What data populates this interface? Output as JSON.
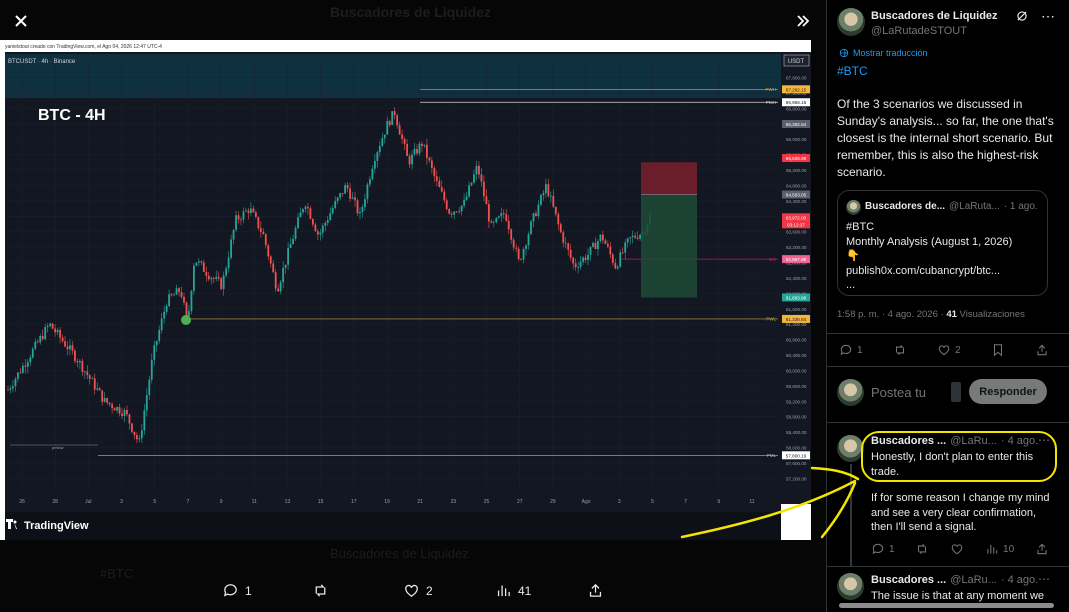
{
  "header": {
    "title": "Buscadores de Liquidez"
  },
  "chart_window": {
    "attribution": "yanielstout creado con TradingView.com, el Ago 04, 2026 12:47 UTC-4",
    "symbol": "BTCUSDT · 4h · Binance",
    "currency": "USDT",
    "overlay_title": "BTC - 4H",
    "brand": "TradingView",
    "level_tags": [
      "PWH",
      "PMH",
      "MO",
      "PWL",
      "PML"
    ],
    "small_label": "pmlow"
  },
  "chart_data": {
    "type": "candlestick",
    "symbol": "BTCUSDT",
    "timeframe": "4h",
    "exchange": "Binance",
    "x_tick_labels": [
      "26",
      "28",
      "Jul",
      "3",
      "5",
      "7",
      "9",
      "11",
      "13",
      "15",
      "17",
      "19",
      "21",
      "23",
      "25",
      "27",
      "29",
      "Ago",
      "3",
      "5",
      "7",
      "9",
      "11"
    ],
    "y_tick_labels": [
      "67,600.00",
      "67,200.00",
      "66,800.00",
      "66,400.00",
      "66,000.00",
      "65,600.00",
      "65,200.00",
      "64,800.00",
      "64,400.00",
      "64,000.00",
      "63,600.00",
      "63,200.00",
      "62,800.00",
      "62,400.00",
      "62,000.00",
      "61,600.00",
      "61,200.00",
      "60,800.00",
      "60,400.00",
      "60,000.00",
      "59,600.00",
      "59,200.00",
      "58,800.00",
      "58,400.00",
      "58,000.00",
      "57,600.00",
      "57,200.00"
    ],
    "ylim": [
      56900,
      68000
    ],
    "price_level_badges": [
      {
        "value": "67,292.15",
        "color": "#f5b73b"
      },
      {
        "value": "66,956.15",
        "color": "#ffffff"
      },
      {
        "value": "66,392.64",
        "color": "#5d606b"
      },
      {
        "value": "65,508.89",
        "color": "#f23645"
      },
      {
        "value": "64,563.05",
        "color": "#5d606b"
      },
      {
        "value": "63,972.00",
        "color": "#f23645"
      },
      {
        "value": "03:12:37",
        "color": "#f23645"
      },
      {
        "value": "62,887.88",
        "color": "#f06292"
      },
      {
        "value": "61,893.98",
        "color": "#26a69a"
      },
      {
        "value": "61,336.84",
        "color": "#f5b73b"
      },
      {
        "value": "57,800.19",
        "color": "#ffffff"
      }
    ],
    "levels": [
      {
        "name": "PWH",
        "price": 67292.15
      },
      {
        "name": "PMH",
        "price": 66956.15
      },
      {
        "name": "MO",
        "price": 62887.88
      },
      {
        "name": "PWL",
        "price": 61336.84
      },
      {
        "name": "PML",
        "price": 57800.19
      }
    ],
    "series_path": [
      [
        0,
        59500
      ],
      [
        6,
        61200
      ],
      [
        10,
        60300
      ],
      [
        14,
        59200
      ],
      [
        17,
        58900
      ],
      [
        19,
        58100
      ],
      [
        21,
        60400
      ],
      [
        23,
        61800
      ],
      [
        25,
        62100
      ],
      [
        26,
        61200
      ],
      [
        27,
        62900
      ],
      [
        29,
        62500
      ],
      [
        31,
        62200
      ],
      [
        33,
        63900
      ],
      [
        35,
        64200
      ],
      [
        37,
        63500
      ],
      [
        39,
        62100
      ],
      [
        41,
        63300
      ],
      [
        43,
        64400
      ],
      [
        45,
        63500
      ],
      [
        47,
        64200
      ],
      [
        49,
        64800
      ],
      [
        51,
        64000
      ],
      [
        53,
        65500
      ],
      [
        55,
        66400
      ],
      [
        56,
        66700
      ],
      [
        58,
        65400
      ],
      [
        60,
        65900
      ],
      [
        62,
        64900
      ],
      [
        64,
        64100
      ],
      [
        66,
        64300
      ],
      [
        68,
        65300
      ],
      [
        70,
        63700
      ],
      [
        72,
        64100
      ],
      [
        74,
        62800
      ],
      [
        76,
        63900
      ],
      [
        78,
        64800
      ],
      [
        80,
        63600
      ],
      [
        82,
        62700
      ],
      [
        84,
        63000
      ],
      [
        86,
        63500
      ],
      [
        88,
        62700
      ],
      [
        90,
        63400
      ],
      [
        92,
        63600
      ],
      [
        93,
        64000
      ]
    ],
    "trade_box": {
      "stop_top": 65400,
      "entry": 64563.05,
      "target": 61893.98
    }
  },
  "bottom_bar": {
    "reply_count": "1",
    "like_count": "2",
    "view_count": "41"
  },
  "ghost_behind": {
    "name": "Buscadores de Liquidez",
    "text": "#BTC"
  },
  "tweet": {
    "name": "Buscadores de Liquidez",
    "handle": "@LaRutadeSTOUT",
    "translate_link": "Mostrar traducción",
    "hashtag": "#BTC",
    "body": "Of the 3 scenarios we discussed in Sunday's analysis... so far, the one that's closest is the internal short scenario. But remember, this is also the highest-risk scenario.",
    "quote": {
      "name": "Buscadores de...",
      "handle": "@LaRuta...",
      "time": "· 1 ago.",
      "line1": "#BTC",
      "line2": "Monthly Analysis (August 1, 2026)",
      "emoji": "👇",
      "line4": "publish0x.com/cubancrypt/btc...",
      "line5": "..."
    },
    "timestamp": "1:58 p. m. · 4 ago. 2026 ·",
    "views_number": "41",
    "views_label": "Visualizaciones",
    "actions": {
      "replies": "1",
      "likes": "2"
    }
  },
  "compose": {
    "placeholder": "Postea tu",
    "reply_button": "Responder"
  },
  "reply": {
    "name": "Buscadores ...",
    "handle": "@LaRu...",
    "time": "· 4 ago.",
    "line1": "Honestly, I don't plan to enter this trade.",
    "line2": "If for some reason I change my mind and see a very clear confirmation, then I'll send a signal.",
    "replies": "1",
    "views": "10"
  },
  "reply2": {
    "name": "Buscadores ...",
    "handle": "@LaRu...",
    "time": "· 4 ago.",
    "text": "The issue is that at any moment we"
  }
}
